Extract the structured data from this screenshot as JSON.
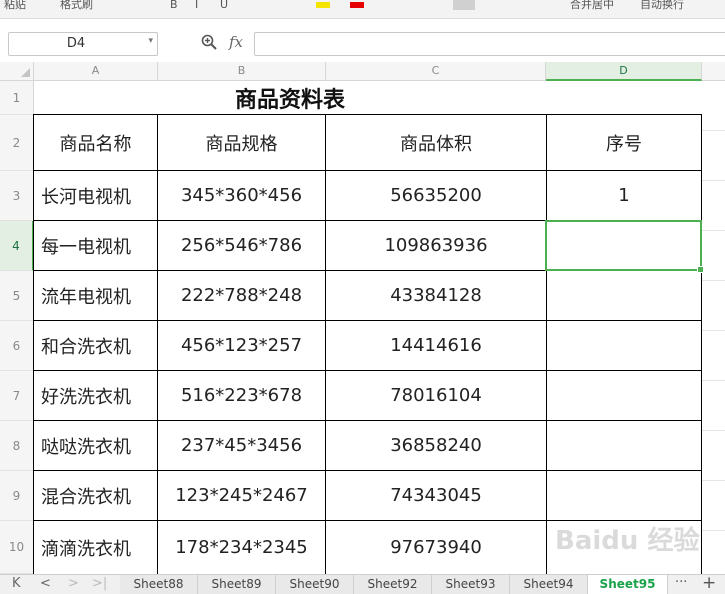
{
  "toolbar": {
    "items": [
      "粘贴",
      "格式刷",
      "B",
      "I",
      "U",
      "A",
      "合并居中",
      "自动换行"
    ]
  },
  "formula_bar": {
    "cell_ref": "D4",
    "zoom_icon": "zoom-icon",
    "fx": "fx",
    "value": ""
  },
  "columns": [
    "A",
    "B",
    "C",
    "D"
  ],
  "rows": [
    "1",
    "2",
    "3",
    "4",
    "5",
    "6",
    "7",
    "8",
    "9",
    "10"
  ],
  "sheet": {
    "title": "商品资料表",
    "headers": [
      "商品名称",
      "商品规格",
      "商品体积",
      "序号"
    ],
    "data": [
      [
        "长河电视机",
        "345*360*456",
        "56635200",
        "1"
      ],
      [
        "每一电视机",
        "256*546*786",
        "109863936",
        ""
      ],
      [
        "流年电视机",
        "222*788*248",
        "43384128",
        ""
      ],
      [
        "和合洗衣机",
        "456*123*257",
        "14414616",
        ""
      ],
      [
        "好洗洗衣机",
        "516*223*678",
        "78016104",
        ""
      ],
      [
        "哒哒洗衣机",
        "237*45*3456",
        "36858240",
        ""
      ],
      [
        "混合洗衣机",
        "123*245*2467",
        "74343045",
        ""
      ],
      [
        "滴滴洗衣机",
        "178*234*2345",
        "97673940",
        ""
      ]
    ]
  },
  "tabs": [
    "Sheet88",
    "Sheet89",
    "Sheet90",
    "Sheet92",
    "Sheet93",
    "Sheet94",
    "Sheet95"
  ],
  "active_tab": "Sheet95",
  "tab_nav": {
    "first": "K",
    "prev": "<",
    "next": ">",
    "last": ">|",
    "more": "···",
    "add": "+"
  },
  "watermark": "Baidu 经验",
  "colors": {
    "accent": "#4caf50",
    "active_tab_text": "#1aa34a"
  }
}
